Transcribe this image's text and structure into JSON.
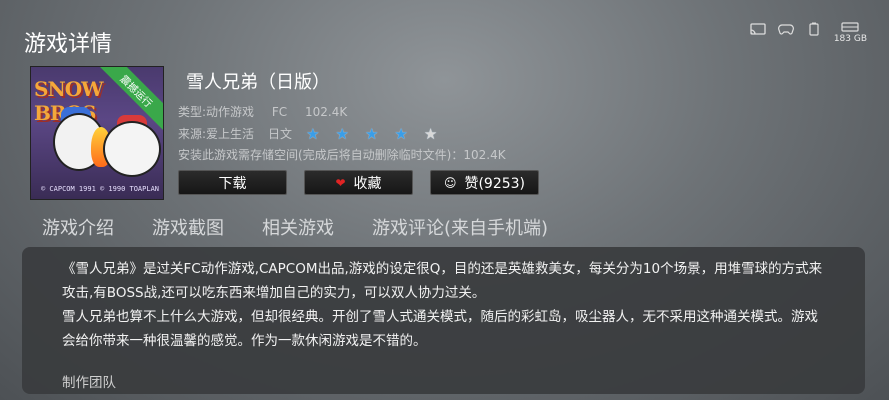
{
  "header": {
    "title": "游戏详情",
    "storage_label": "183 GB"
  },
  "game": {
    "cover_ribbon": "震撼运行",
    "cover_title": "SNOW BROS",
    "cover_copyright": "© CAPCOM 1991  © 1990 TOAPLAN",
    "title": "雪人兄弟（日版）",
    "type": "类型:动作游戏",
    "platform": "FC",
    "size": "102.4K",
    "source": "来源:爱上生活",
    "language": "日文",
    "rating": 4,
    "rating_max": 5,
    "space_note": "安装此游戏需存储空间(完成后将自动删除临时文件)：102.4K"
  },
  "buttons": {
    "download": "下载",
    "favorite": "收藏",
    "like": "赞(9253)"
  },
  "tabs": [
    "游戏介绍",
    "游戏截图",
    "相关游戏",
    "游戏评论(来自手机端)"
  ],
  "description": {
    "para1": "《雪人兄弟》是过关FC动作游戏,CAPCOM出品,游戏的设定很Q，目的还是英雄救美女，每关分为10个场景，用堆雪球的方式来攻击,有BOSS战,还可以吃东西来增加自己的实力，可以双人协力过关。",
    "para2": "雪人兄弟也算不上什么大游戏，但却很经典。开创了雪人式通关模式，随后的彩虹岛，吸尘器人，无不采用这种通关模式。游戏会给你带来一种很温馨的感觉。作为一款休闲游戏是不错的。",
    "credit_heading": "制作团队"
  },
  "colors": {
    "star_filled": "#3a9ee8",
    "star_empty": "#d8d8d8",
    "heart": "#e02424",
    "ribbon": "#3aa84a"
  }
}
